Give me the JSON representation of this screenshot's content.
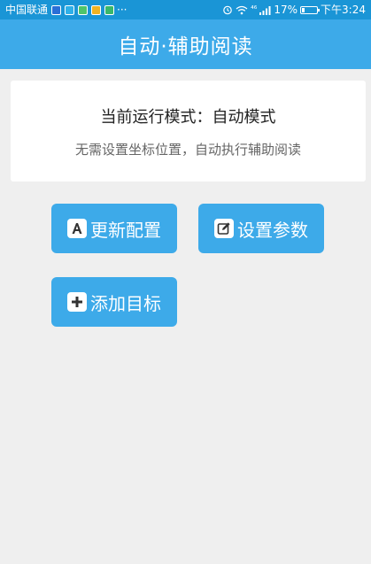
{
  "status_bar": {
    "carrier": "中国联通",
    "more": "···",
    "network": "⁴⁶",
    "battery_percent": "17%",
    "battery_level": 0.17,
    "time": "下午3:24"
  },
  "header": {
    "title": "自动·辅助阅读"
  },
  "info_card": {
    "mode_text": "当前运行模式：自动模式",
    "description": "无需设置坐标位置，自动执行辅助阅读"
  },
  "actions": {
    "update_config_label": "更新配置",
    "set_params_label": "设置参数",
    "add_target_label": "添加目标"
  },
  "colors": {
    "status_bar": "#1a95d6",
    "primary": "#3daae9",
    "background": "#efefef"
  }
}
